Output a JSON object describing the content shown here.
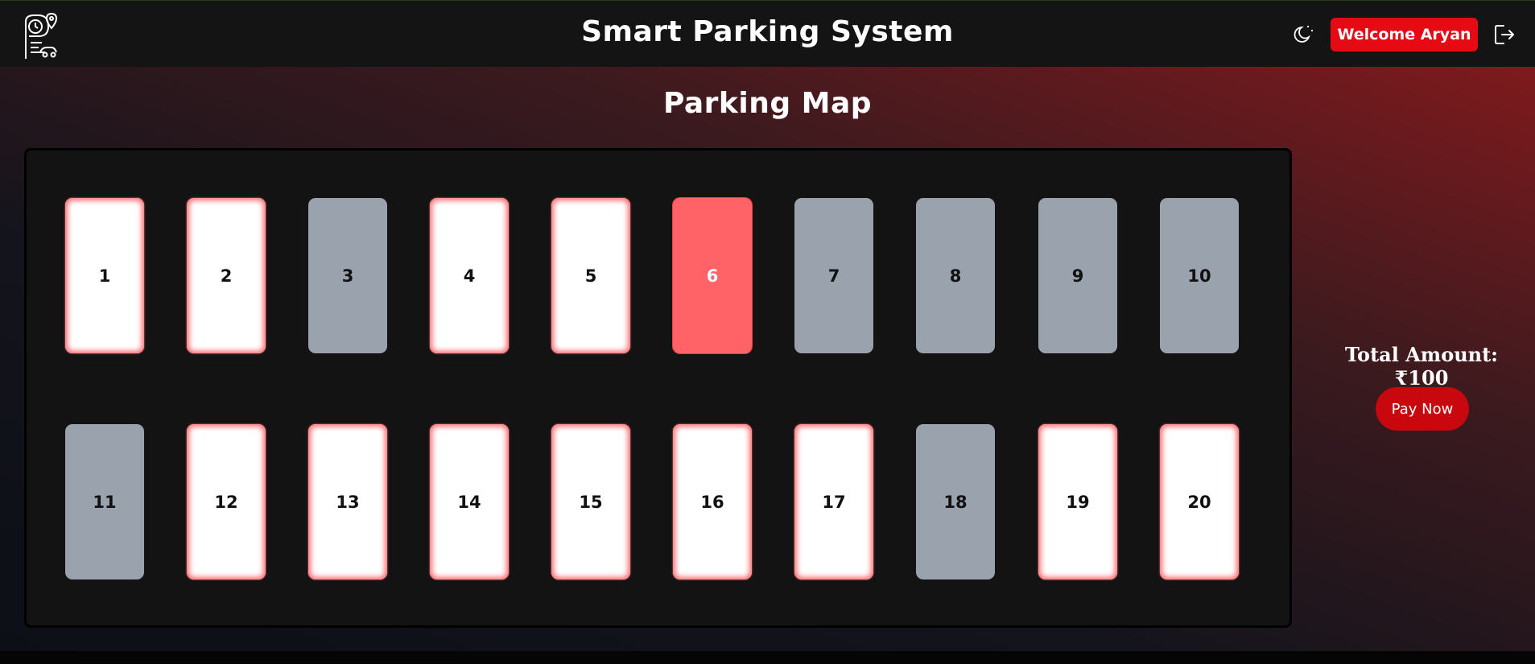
{
  "header": {
    "title": "Smart Parking System",
    "welcome_label": "Welcome Aryan",
    "icons": {
      "logo": "parking-logo-icon",
      "theme": "moon-icon",
      "logout": "logout-icon"
    }
  },
  "main": {
    "heading": "Parking Map",
    "slots": [
      {
        "label": "1",
        "status": "available"
      },
      {
        "label": "2",
        "status": "available"
      },
      {
        "label": "3",
        "status": "occupied"
      },
      {
        "label": "4",
        "status": "available"
      },
      {
        "label": "5",
        "status": "available"
      },
      {
        "label": "6",
        "status": "selected"
      },
      {
        "label": "7",
        "status": "occupied"
      },
      {
        "label": "8",
        "status": "occupied"
      },
      {
        "label": "9",
        "status": "occupied"
      },
      {
        "label": "10",
        "status": "occupied"
      },
      {
        "label": "11",
        "status": "occupied"
      },
      {
        "label": "12",
        "status": "available"
      },
      {
        "label": "13",
        "status": "available"
      },
      {
        "label": "14",
        "status": "available"
      },
      {
        "label": "15",
        "status": "available"
      },
      {
        "label": "16",
        "status": "available"
      },
      {
        "label": "17",
        "status": "available"
      },
      {
        "label": "18",
        "status": "occupied"
      },
      {
        "label": "19",
        "status": "available"
      },
      {
        "label": "20",
        "status": "available"
      }
    ]
  },
  "summary": {
    "total_label": "Total Amount: ₹100",
    "pay_label": "Pay Now"
  },
  "colors": {
    "accent": "#e60a14",
    "available": "#ffffff",
    "occupied": "#9aa2ad",
    "selected": "#ff6368"
  }
}
